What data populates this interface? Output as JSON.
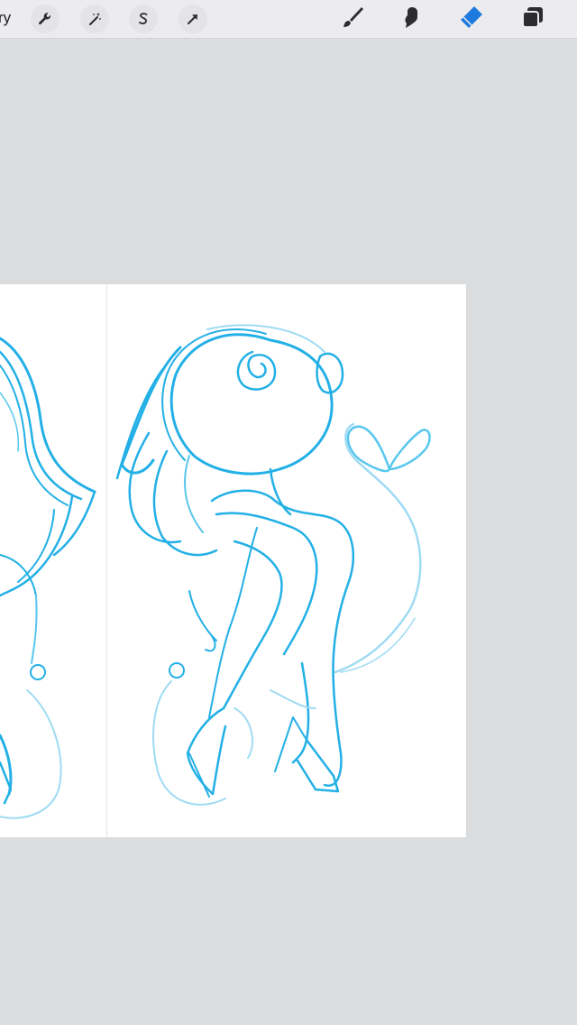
{
  "toolbar": {
    "gallery_label": "ry",
    "left_tools": [
      {
        "icon": "wrench-icon",
        "name": "actions-button"
      },
      {
        "icon": "magic-wand-icon",
        "name": "adjustments-button"
      },
      {
        "icon": "selection-s-icon",
        "name": "selection-button"
      },
      {
        "icon": "arrow-cursor-icon",
        "name": "transform-button"
      }
    ],
    "right_tools": [
      {
        "icon": "brush-icon",
        "name": "brush-button"
      },
      {
        "icon": "smudge-icon",
        "name": "smudge-button"
      },
      {
        "icon": "eraser-icon",
        "name": "eraser-button",
        "active": true
      },
      {
        "icon": "layers-icon",
        "name": "layers-button"
      }
    ]
  },
  "colors": {
    "background": "#dcdddf",
    "toolbar": "#ececee",
    "canvas": "#ffffff",
    "active_tool": "#1f7ae0",
    "sketch_dark": "#23b0e6",
    "sketch_light": "#9fdbf3"
  }
}
